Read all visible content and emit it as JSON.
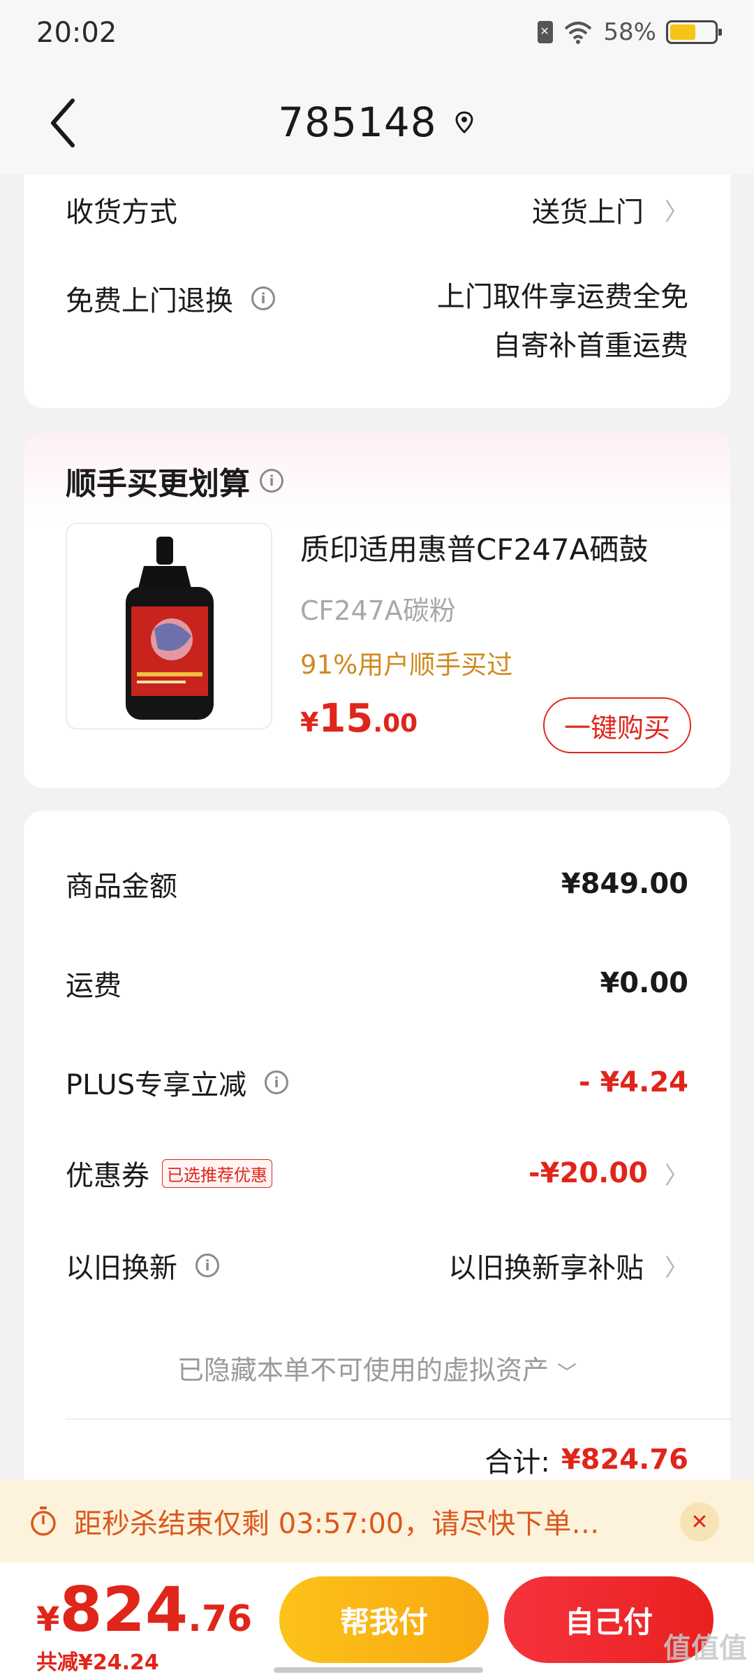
{
  "status_bar": {
    "time": "20:02",
    "battery": "58%",
    "battery_level": 0.58
  },
  "nav": {
    "title": "785148"
  },
  "delivery": {
    "method_label": "收货方式",
    "method_value": "送货上门",
    "return_label": "免费上门退换",
    "return_line1": "上门取件享运费全免",
    "return_line2": "自寄补首重运费"
  },
  "upsell": {
    "title": "顺手买更划算",
    "product_name": "质印适用惠普CF247A硒鼓",
    "product_sub": "CF247A碳粉",
    "stat": "91%用户顺手买过",
    "price_symbol": "¥",
    "price_int": "15",
    "price_dec": ".00",
    "buy_label": "一键购买"
  },
  "summary": {
    "goods_label": "商品金额",
    "goods_value": "¥849.00",
    "shipping_label": "运费",
    "shipping_value": "¥0.00",
    "plus_label": "PLUS专享立减",
    "plus_value": "- ¥4.24",
    "coupon_label": "优惠券",
    "coupon_tag": "已选推荐优惠",
    "coupon_value": "-¥20.00",
    "tradein_label": "以旧换新",
    "tradein_value": "以旧换新享补贴",
    "hidden_note": "已隐藏本单不可使用的虚拟资产",
    "total_label": "合计:",
    "total_value": "¥824.76"
  },
  "countdown": {
    "text": "距秒杀结束仅剩 03:57:00，请尽快下单…"
  },
  "bottom": {
    "price_symbol": "¥",
    "price_int": "824",
    "price_dec": ".76",
    "saved": "共减¥24.24",
    "help_pay": "帮我付",
    "self_pay": "自己付",
    "watermark": "值值值"
  },
  "colors": {
    "accent_red": "#e0251a",
    "accent_orange": "#fcc21a",
    "stat_orange": "#d08a1e"
  }
}
